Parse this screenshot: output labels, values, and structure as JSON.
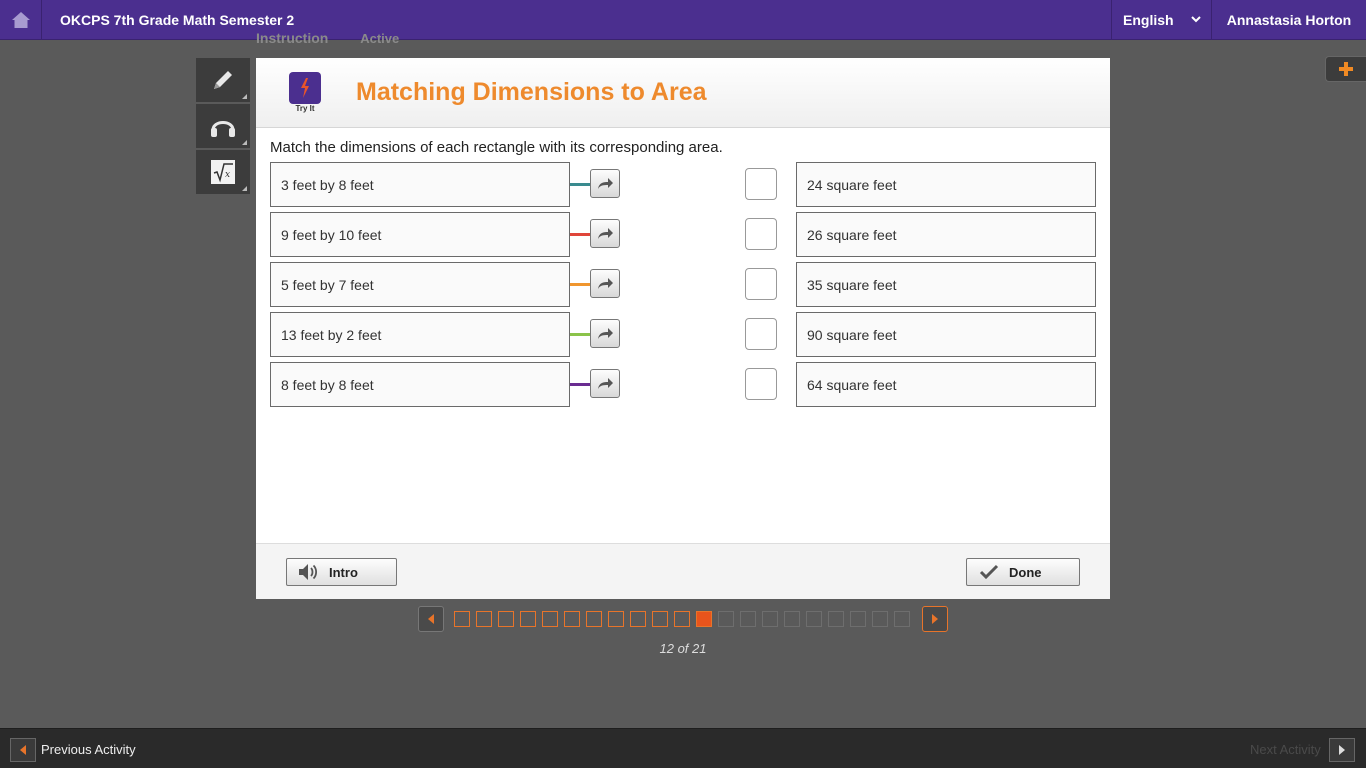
{
  "topbar": {
    "course_title": "OKCPS 7th Grade Math Semester 2",
    "language": "English",
    "user_name": "Annastasia Horton"
  },
  "subtabs": {
    "instruction": "Instruction",
    "active": "Active"
  },
  "tools": [
    "pencil-icon",
    "headphones-icon",
    "sqrt-icon"
  ],
  "activity": {
    "logo_label": "Try It",
    "title": "Matching Dimensions to Area",
    "instructions": "Match the dimensions of each rectangle with its corresponding area.",
    "left_items": [
      {
        "label": "3 feet by 8 feet",
        "color": "#3a8b8f"
      },
      {
        "label": "9 feet by 10 feet",
        "color": "#e0463a"
      },
      {
        "label": "5 feet by 7 feet",
        "color": "#f0962f"
      },
      {
        "label": "13 feet by 2 feet",
        "color": "#8bc34a"
      },
      {
        "label": "8 feet by 8 feet",
        "color": "#6a2c91"
      }
    ],
    "right_items": [
      {
        "label": "24 square feet"
      },
      {
        "label": "26 square feet"
      },
      {
        "label": "35 square feet"
      },
      {
        "label": "90 square feet"
      },
      {
        "label": "64 square feet"
      }
    ],
    "intro_label": "Intro",
    "done_label": "Done"
  },
  "pager": {
    "total": 21,
    "current": 12,
    "counter_text": "12 of 21"
  },
  "bottombar": {
    "prev_label": "Previous Activity",
    "next_label": "Next Activity"
  },
  "colors": {
    "brand_purple": "#4b2f8f",
    "title_orange": "#ee8a2d",
    "pager_orange": "#e8742a"
  }
}
